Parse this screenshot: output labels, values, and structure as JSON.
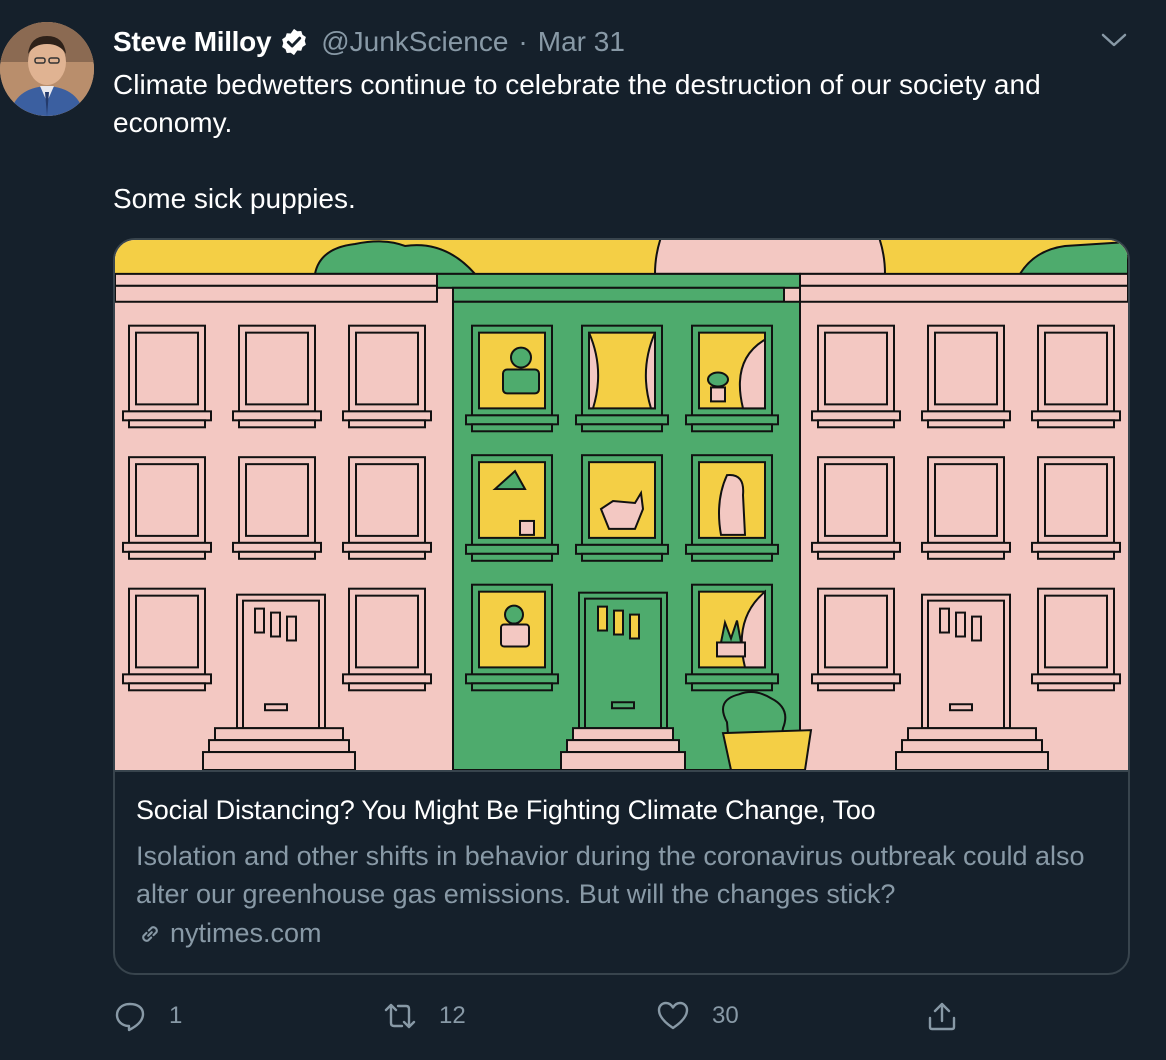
{
  "tweet": {
    "author_name": "Steve Milloy",
    "author_handle": "@JunkScience",
    "separator": "·",
    "date": "Mar 31",
    "text_line1": "Climate bedwetters continue to celebrate the destruction of our society and economy.",
    "text_line2": "Some sick puppies."
  },
  "card": {
    "title": "Social Distancing? You Might Be Fighting Climate Change, Too",
    "description": "Isolation and other shifts in behavior during the coronavirus outbreak could also alter our greenhouse gas emissions. But will the changes stick?",
    "domain": "nytimes.com"
  },
  "actions": {
    "reply_count": "1",
    "retweet_count": "12",
    "like_count": "30"
  },
  "icons": {
    "verified": "verified-badge-icon",
    "more": "chevron-down-icon",
    "link": "link-icon",
    "reply": "reply-icon",
    "retweet": "retweet-icon",
    "like": "heart-icon",
    "share": "share-icon"
  },
  "colors": {
    "background": "#15202b",
    "secondary_text": "#8899a6",
    "border": "#38444d"
  }
}
